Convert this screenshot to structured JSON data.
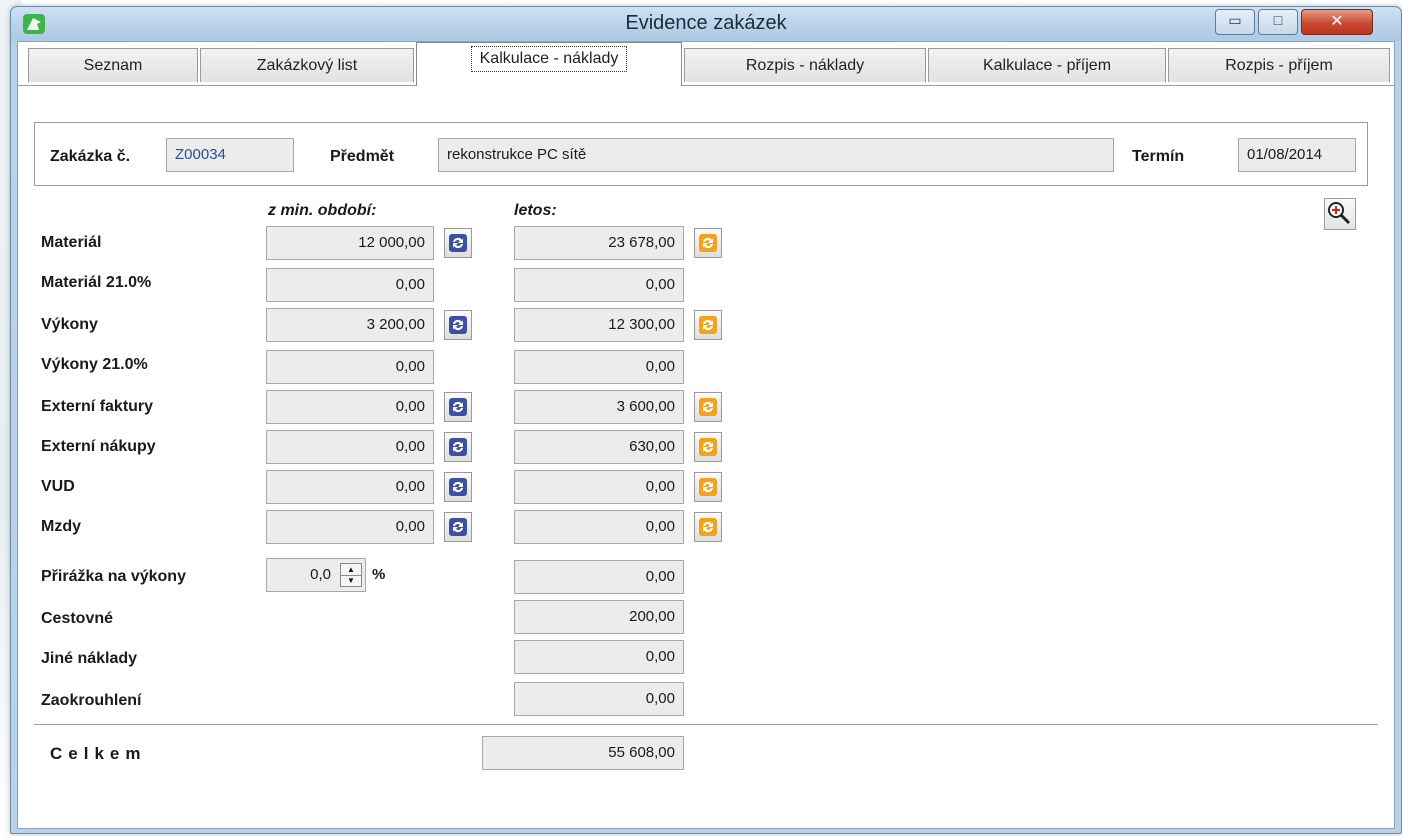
{
  "window": {
    "title": "Evidence zakázek"
  },
  "tabs": [
    {
      "label": "Seznam",
      "active": false
    },
    {
      "label": "Zakázkový list",
      "active": false
    },
    {
      "label": "Kalkulace - náklady",
      "active": true
    },
    {
      "label": "Rozpis - náklady",
      "active": false
    },
    {
      "label": "Kalkulace - příjem",
      "active": false
    },
    {
      "label": "Rozpis - příjem",
      "active": false
    }
  ],
  "header": {
    "order_label": "Zakázka č.",
    "order_value": "Z00034",
    "subject_label": "Předmět",
    "subject_value": "rekonstrukce PC sítě",
    "deadline_label": "Termín",
    "deadline_value": "01/08/2014"
  },
  "columns": {
    "prev": "z min. období:",
    "current": "letos:"
  },
  "rows": [
    {
      "label": "Materiál",
      "prev": "12 000,00",
      "current": "23 678,00"
    },
    {
      "label": "Materiál 21.0%",
      "prev": "0,00",
      "current": "0,00"
    },
    {
      "label": "Výkony",
      "prev": "3 200,00",
      "current": "12 300,00"
    },
    {
      "label": "Výkony 21.0%",
      "prev": "0,00",
      "current": "0,00"
    },
    {
      "label": "Externí faktury",
      "prev": "0,00",
      "current": "3 600,00"
    },
    {
      "label": "Externí nákupy",
      "prev": "0,00",
      "current": "630,00"
    },
    {
      "label": "VUD",
      "prev": "0,00",
      "current": "0,00"
    },
    {
      "label": "Mzdy",
      "prev": "0,00",
      "current": "0,00"
    }
  ],
  "surcharge": {
    "label": "Přirážka na výkony",
    "percent": "0,0",
    "unit": "%",
    "value": "0,00"
  },
  "extras": [
    {
      "label": "Cestovné",
      "value": "200,00"
    },
    {
      "label": "Jiné náklady",
      "value": "0,00"
    },
    {
      "label": "Zaokrouhlení",
      "value": "0,00"
    }
  ],
  "total": {
    "label": "Celkem",
    "value": "55 608,00"
  },
  "colors": {
    "refresh_blue": "#3d4fa3",
    "refresh_orange": "#f2a31d",
    "titlebar": "#b9d3ea"
  }
}
